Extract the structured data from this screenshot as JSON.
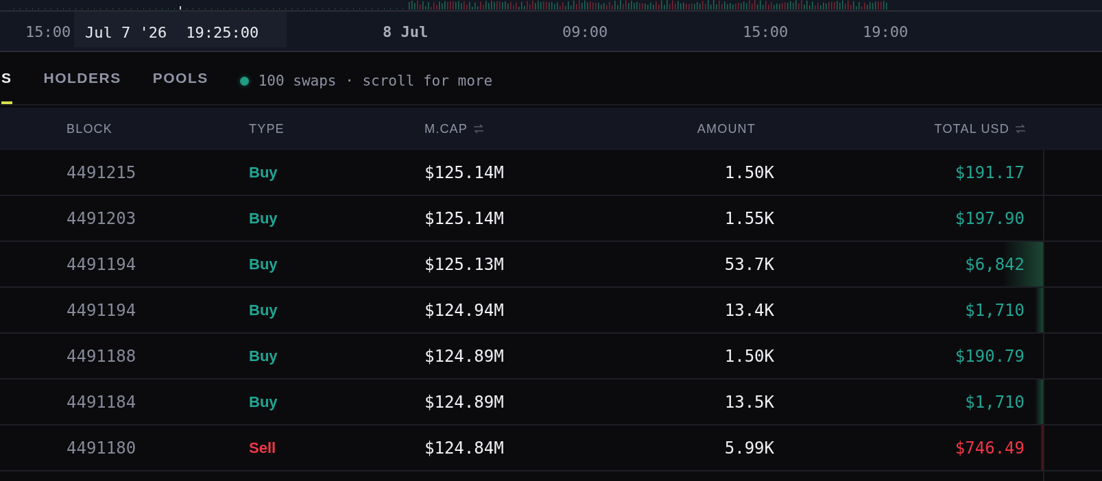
{
  "time_axis": {
    "labels": [
      {
        "text": "15:00",
        "kind": "time"
      },
      {
        "text": "8 Jul",
        "kind": "date"
      },
      {
        "text": "09:00",
        "kind": "time"
      },
      {
        "text": "15:00",
        "kind": "time"
      },
      {
        "text": "19:00",
        "kind": "time"
      }
    ],
    "crosshair": {
      "date": "Jul 7 '26",
      "time": "19:25:00"
    }
  },
  "tabs": [
    {
      "label": "S",
      "selected": true
    },
    {
      "label": "HOLDERS",
      "selected": false
    },
    {
      "label": "POOLS",
      "selected": false
    }
  ],
  "status": {
    "live": true,
    "text": "100 swaps · scroll for more"
  },
  "table": {
    "columns": [
      {
        "label": "BLOCK",
        "sortable": false
      },
      {
        "label": "TYPE",
        "sortable": false
      },
      {
        "label": "M.CAP",
        "sortable": true
      },
      {
        "label": "AMOUNT",
        "sortable": false
      },
      {
        "label": "TOTAL USD",
        "sortable": true
      }
    ],
    "rows": [
      {
        "block": "4491215",
        "type": "Buy",
        "kind": "buy",
        "mcap": "$125.14M",
        "amount": "1.50K",
        "total": "$191.17"
      },
      {
        "block": "4491203",
        "type": "Buy",
        "kind": "buy",
        "mcap": "$125.14M",
        "amount": "1.55K",
        "total": "$197.90"
      },
      {
        "block": "4491194",
        "type": "Buy",
        "kind": "buy",
        "mcap": "$125.13M",
        "amount": "53.7K",
        "total": "$6,842",
        "level": 0.15
      },
      {
        "block": "4491194",
        "type": "Buy",
        "kind": "buy",
        "mcap": "$124.94M",
        "amount": "13.4K",
        "total": "$1,710",
        "level": 0.03
      },
      {
        "block": "4491188",
        "type": "Buy",
        "kind": "buy",
        "mcap": "$124.89M",
        "amount": "1.50K",
        "total": "$190.79"
      },
      {
        "block": "4491184",
        "type": "Buy",
        "kind": "buy",
        "mcap": "$124.89M",
        "amount": "13.5K",
        "total": "$1,710",
        "level": 0.03
      },
      {
        "block": "4491180",
        "type": "Sell",
        "kind": "sell",
        "mcap": "$124.84M",
        "amount": "5.99K",
        "total": "$746.49",
        "level": 0.01
      }
    ]
  }
}
